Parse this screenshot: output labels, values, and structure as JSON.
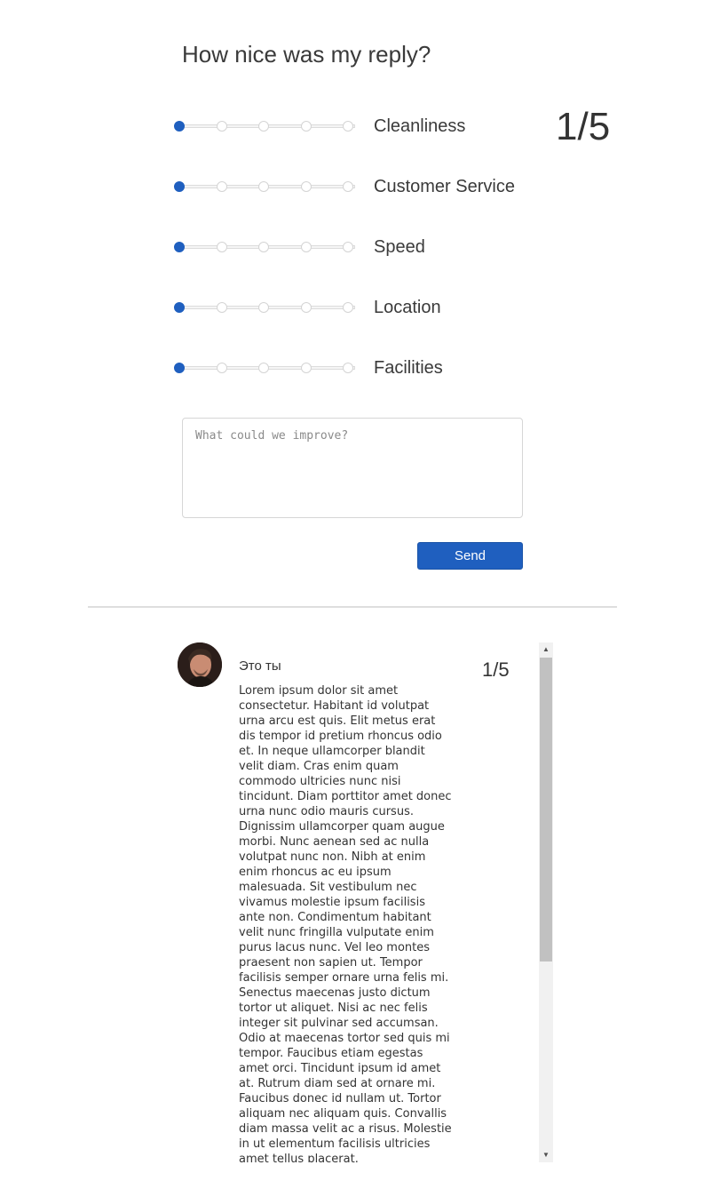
{
  "survey": {
    "title": "How nice was my reply?",
    "overall_score": "1/5",
    "ratings": [
      {
        "label": "Cleanliness",
        "value": 1,
        "max": 5
      },
      {
        "label": "Customer Service",
        "value": 1,
        "max": 5
      },
      {
        "label": "Speed",
        "value": 1,
        "max": 5
      },
      {
        "label": "Location",
        "value": 1,
        "max": 5
      },
      {
        "label": "Facilities",
        "value": 1,
        "max": 5
      }
    ],
    "feedback_placeholder": "What could we improve?",
    "feedback_value": "",
    "send_label": "Send"
  },
  "review": {
    "author": "Это ты",
    "score": "1/5",
    "text": "Lorem ipsum dolor sit amet consectetur. Habitant id volutpat urna arcu est quis. Elit metus erat dis tempor id pretium rhoncus odio et. In neque ullamcorper blandit velit diam. Cras enim quam commodo ultricies nunc nisi tincidunt. Diam porttitor amet donec urna nunc odio mauris cursus. Dignissim ullamcorper quam augue morbi. Nunc aenean sed ac nulla volutpat nunc non. Nibh at enim enim rhoncus ac eu ipsum malesuada. Sit vestibulum nec vivamus molestie ipsum facilisis ante non. Condimentum habitant velit nunc fringilla vulputate enim purus lacus nunc. Vel leo montes praesent non sapien ut. Tempor facilisis semper ornare urna felis mi. Senectus maecenas justo dictum tortor ut aliquet. Nisi ac nec felis integer sit pulvinar sed accumsan. Odio at maecenas tortor sed quis mi tempor. Faucibus etiam egestas amet orci. Tincidunt ipsum id amet at. Rutrum diam sed at ornare mi. Faucibus donec id nullam ut. Tortor aliquam nec aliquam quis. Convallis diam massa velit ac a risus. Molestie in ut elementum facilisis ultricies amet tellus placerat."
  },
  "colors": {
    "accent": "#1f5fbf",
    "track": "#f5f5f5",
    "divider": "#dedede"
  }
}
